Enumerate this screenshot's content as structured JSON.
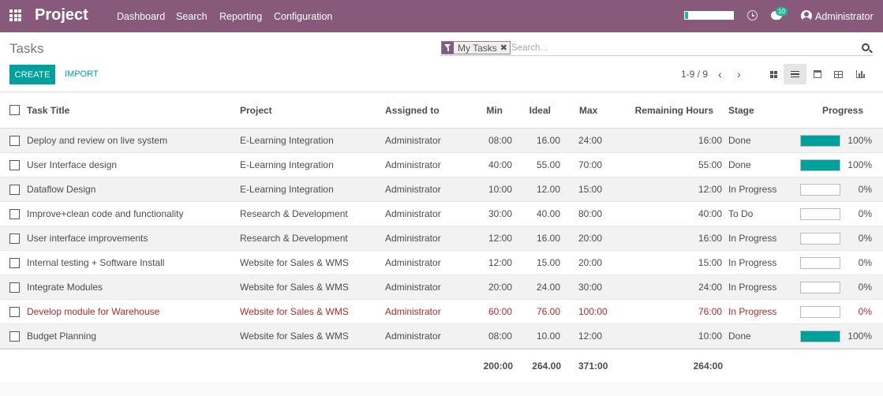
{
  "navbar": {
    "brand": "Project",
    "menu": [
      "Dashboard",
      "Search",
      "Reporting",
      "Configuration"
    ],
    "chat_count": "10",
    "user": "Administrator",
    "icons": [
      "apps-grid-icon",
      "clock-icon",
      "chat-icon",
      "avatar"
    ]
  },
  "control": {
    "title": "Tasks",
    "facet_label": "My Tasks",
    "search_placeholder": "Search...",
    "create_label": "CREATE",
    "import_label": "IMPORT",
    "pager": "1-9 / 9",
    "pager_prev": "‹",
    "pager_next": "›",
    "views": [
      "kanban",
      "list",
      "calendar",
      "pivot",
      "graph"
    ],
    "active_view": "list"
  },
  "columns": {
    "title": "Task Title",
    "project": "Project",
    "assigned": "Assigned to",
    "min": "Min",
    "ideal": "Ideal",
    "max": "Max",
    "remaining": "Remaining Hours",
    "stage": "Stage",
    "progress": "Progress"
  },
  "rows": [
    {
      "title": "Deploy and review on live system",
      "project": "E-Learning Integration",
      "assigned": "Administrator",
      "min": "08:00",
      "ideal": "16.00",
      "max": "24:00",
      "remaining": "16:00",
      "stage": "Done",
      "progress": 100,
      "progress_label": "100%"
    },
    {
      "title": "User Interface design",
      "project": "E-Learning Integration",
      "assigned": "Administrator",
      "min": "40:00",
      "ideal": "55.00",
      "max": "70:00",
      "remaining": "55:00",
      "stage": "Done",
      "progress": 100,
      "progress_label": "100%"
    },
    {
      "title": "Dataflow Design",
      "project": "E-Learning Integration",
      "assigned": "Administrator",
      "min": "10:00",
      "ideal": "12.00",
      "max": "15:00",
      "remaining": "12:00",
      "stage": "In Progress",
      "progress": 0,
      "progress_label": "0%"
    },
    {
      "title": "Improve+clean code and functionality",
      "project": "Research & Development",
      "assigned": "Administrator",
      "min": "30:00",
      "ideal": "40.00",
      "max": "80:00",
      "remaining": "40:00",
      "stage": "To Do",
      "progress": 0,
      "progress_label": "0%"
    },
    {
      "title": "User interface improvements",
      "project": "Research & Development",
      "assigned": "Administrator",
      "min": "12:00",
      "ideal": "16.00",
      "max": "20:00",
      "remaining": "16:00",
      "stage": "In Progress",
      "progress": 0,
      "progress_label": "0%"
    },
    {
      "title": "Internal testing + Software Install",
      "project": "Website for Sales & WMS",
      "assigned": "Administrator",
      "min": "12:00",
      "ideal": "15.00",
      "max": "20:00",
      "remaining": "15:00",
      "stage": "In Progress",
      "progress": 0,
      "progress_label": "0%"
    },
    {
      "title": "Integrate Modules",
      "project": "Website for Sales & WMS",
      "assigned": "Administrator",
      "min": "20:00",
      "ideal": "24.00",
      "max": "30:00",
      "remaining": "24:00",
      "stage": "In Progress",
      "progress": 0,
      "progress_label": "0%"
    },
    {
      "title": "Develop module for Warehouse",
      "project": "Website for Sales & WMS",
      "assigned": "Administrator",
      "min": "60:00",
      "ideal": "76.00",
      "max": "100:00",
      "remaining": "76:00",
      "stage": "In Progress",
      "progress": 0,
      "progress_label": "0%",
      "overdue": true
    },
    {
      "title": "Budget Planning",
      "project": "Website for Sales & WMS",
      "assigned": "Administrator",
      "min": "08:00",
      "ideal": "10.00",
      "max": "12:00",
      "remaining": "10:00",
      "stage": "Done",
      "progress": 100,
      "progress_label": "100%"
    }
  ],
  "totals": {
    "min": "200:00",
    "ideal": "264.00",
    "max": "371:00",
    "remaining": "264:00"
  },
  "colors": {
    "brand": "#875a7b",
    "accent": "#00a09d",
    "overdue": "#b1292c"
  }
}
